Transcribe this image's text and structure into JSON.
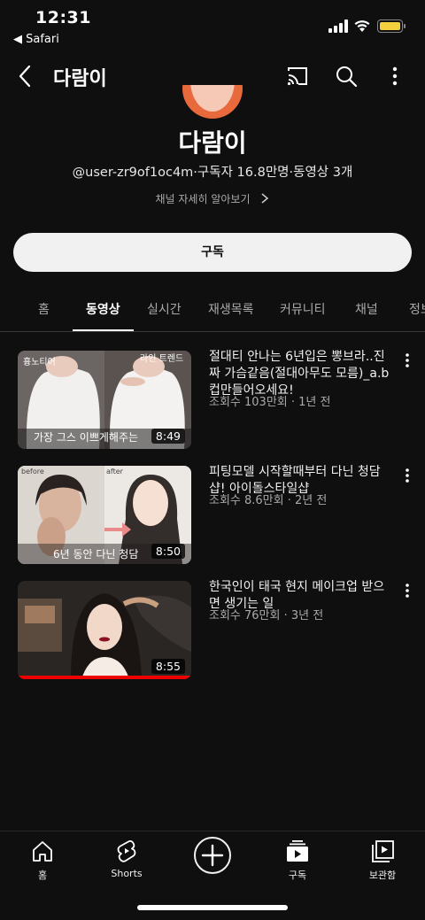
{
  "status_bar": {
    "time": "12:31",
    "back_app": "◀ Safari"
  },
  "app_bar": {
    "title": "다람이",
    "icons": [
      "back-icon",
      "cast-icon",
      "search-icon",
      "more-vertical-icon"
    ]
  },
  "channel": {
    "name": "다람이",
    "meta": "@user-zr9of1oc4m·구독자 16.8만명·동영상 3개",
    "more_link": "채널 자세히 알아보기",
    "subscribe_label": "구독",
    "avatar_colors": {
      "ring": "#e8693c",
      "face": "#f6c8b6"
    }
  },
  "tabs": [
    "홈",
    "동영상",
    "실시간",
    "재생목록",
    "커뮤니티",
    "채널",
    "정보"
  ],
  "active_tab": "동영상",
  "videos": [
    {
      "title": "절대티 안나는 6년입은 뽕브라..진짜 가슴같음(절대아무도 모름)_a.b 컵만들어오세요!",
      "meta": "조회수 103만회 · 1년 전",
      "duration": "8:49"
    },
    {
      "title": "피팅모델 시작할때부터 다닌 청담샵! 아이돌스타일샵",
      "meta": "조회수 8.6만회 · 2년 전",
      "duration": "8:50"
    },
    {
      "title": "한국인이 태국 현지 메이크업 받으면 생기는 일",
      "meta": "조회수 76만회 · 3년 전",
      "duration": "8:55"
    }
  ],
  "bottom_nav": [
    {
      "label": "홈",
      "icon": "home-icon"
    },
    {
      "label": "Shorts",
      "icon": "shorts-icon"
    },
    {
      "label": "",
      "icon": "create-plus-icon"
    },
    {
      "label": "구독",
      "icon": "subscriptions-icon"
    },
    {
      "label": "보관함",
      "icon": "library-icon"
    }
  ]
}
